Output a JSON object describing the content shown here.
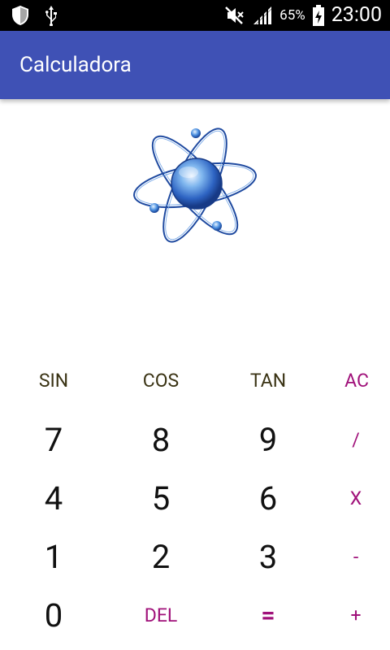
{
  "status_bar": {
    "battery_percent": "65%",
    "time": "23:00",
    "icons": [
      "shield-icon",
      "usb-icon",
      "mute-icon",
      "signal-icon",
      "battery-charging-icon"
    ]
  },
  "app_bar": {
    "title": "Calculadora",
    "color": "#3f51b5"
  },
  "logo": {
    "icon": "atom-icon"
  },
  "keypad": {
    "rows": [
      [
        "SIN",
        "COS",
        "TAN",
        "AC"
      ],
      [
        "7",
        "8",
        "9",
        "/"
      ],
      [
        "4",
        "5",
        "6",
        "X"
      ],
      [
        "1",
        "2",
        "3",
        "-"
      ],
      [
        "0",
        "DEL",
        "=",
        "+"
      ]
    ]
  },
  "colors": {
    "accent": "#a0117a",
    "function_text": "#3a3314",
    "digit_text": "#111111"
  }
}
